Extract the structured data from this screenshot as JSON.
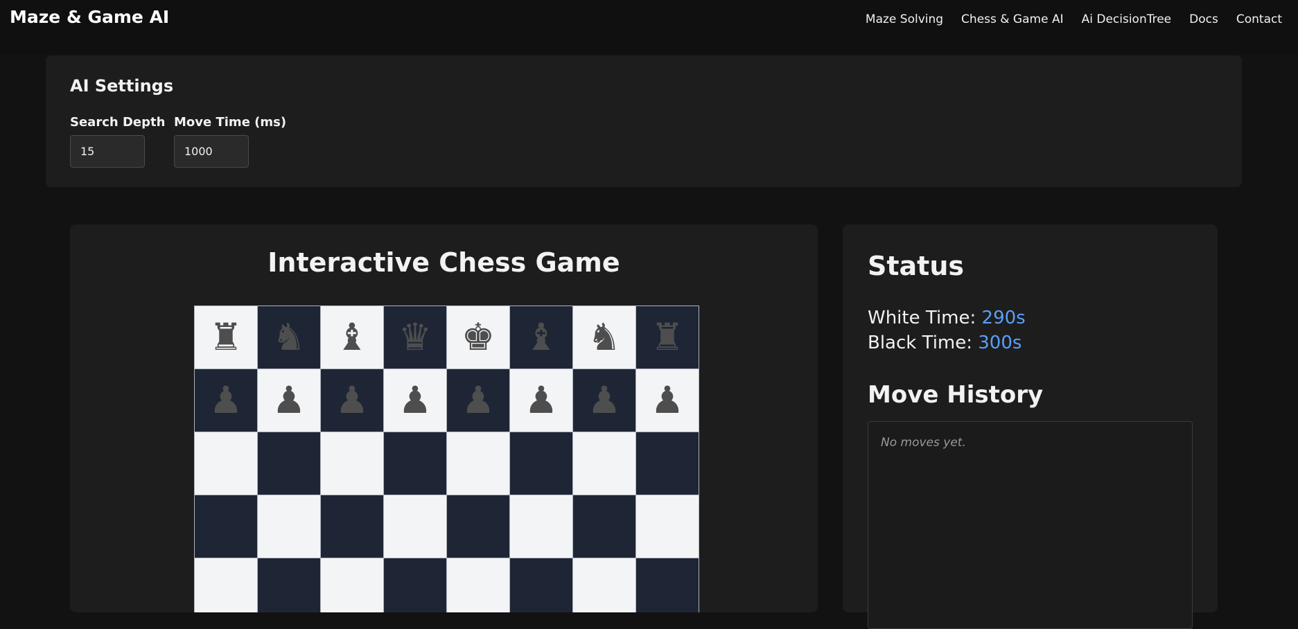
{
  "nav": {
    "brand": "Maze & Game AI",
    "links": [
      "Maze Solving",
      "Chess & Game AI",
      "Ai DecisionTree",
      "Docs",
      "Contact"
    ]
  },
  "settings": {
    "title": "AI Settings",
    "depth_label": "Search Depth",
    "depth_value": "15",
    "time_label": "Move Time (ms)",
    "time_value": "1000"
  },
  "game": {
    "title": "Interactive Chess Game",
    "board_rows": [
      [
        "♜",
        "♞",
        "♝",
        "♛",
        "♚",
        "♝",
        "♞",
        "♜"
      ],
      [
        "♟",
        "♟",
        "♟",
        "♟",
        "♟",
        "♟",
        "♟",
        "♟"
      ],
      [
        "",
        "",
        "",
        "",
        "",
        "",
        "",
        ""
      ],
      [
        "",
        "",
        "",
        "",
        "",
        "",
        "",
        ""
      ],
      [
        "",
        "",
        "",
        "",
        "",
        "",
        "",
        ""
      ]
    ]
  },
  "status": {
    "title": "Status",
    "white_label": "White Time:",
    "white_value": "290s",
    "black_label": "Black Time:",
    "black_value": "300s",
    "history_title": "Move History",
    "history_empty": "No moves yet."
  },
  "colors": {
    "accent": "#5b9ef7",
    "light_square": "#f3f4f6",
    "dark_square": "#1e2636"
  }
}
